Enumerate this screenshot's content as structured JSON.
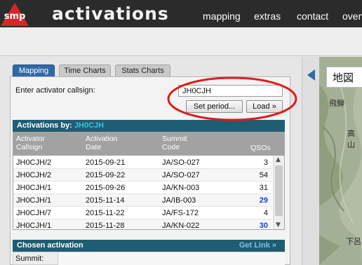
{
  "header": {
    "logo_text": "smp",
    "title": "activations",
    "nav": [
      "mapping",
      "extras",
      "contact",
      "overv"
    ]
  },
  "tabs": {
    "mapping": "Mapping",
    "time_charts": "Time Charts",
    "stats_charts": "Stats Charts"
  },
  "form": {
    "callsign_label": "Enter activator callsign:",
    "callsign_value": "JH0CJH",
    "set_period_button": "Set period...",
    "load_button": "Load »"
  },
  "activations": {
    "header_label": "Activations by:",
    "header_callsign": "JH0CJH",
    "columns": {
      "activator": [
        "Activator",
        "Callsign"
      ],
      "date": [
        "Activation",
        "Date"
      ],
      "summit": [
        "Summit",
        "Code"
      ],
      "qsos": "QSOs"
    },
    "rows": [
      {
        "callsign": "JH0CJH/2",
        "date": "2015-09-21",
        "summit": "JA/SO-027",
        "qsos": "3"
      },
      {
        "callsign": "JH0CJH/2",
        "date": "2015-09-22",
        "summit": "JA/SO-027",
        "qsos": "54"
      },
      {
        "callsign": "JH0CJH/1",
        "date": "2015-09-26",
        "summit": "JA/KN-003",
        "qsos": "31"
      },
      {
        "callsign": "JH0CJH/1",
        "date": "2015-11-14",
        "summit": "JA/IB-003",
        "qsos": "29"
      },
      {
        "callsign": "JH0CJH/7",
        "date": "2015-11-22",
        "summit": "JA/FS-172",
        "qsos": "4"
      },
      {
        "callsign": "JH0CJH/1",
        "date": "2015-11-28",
        "summit": "JA/KN-022",
        "qsos": "30"
      }
    ]
  },
  "chosen": {
    "title": "Chosen activation",
    "get_link": "Get Link »",
    "summit_label": "Summit:"
  },
  "map": {
    "label": "地図",
    "places": [
      "飛騨",
      "高山",
      "下呂"
    ]
  },
  "colors": {
    "topbar": "#2b2b2b",
    "tab_active": "#2f6aa8",
    "section_header": "#1f5d73",
    "callsign_accent": "#37c3e0",
    "qso_highlight": "#1d3fd0",
    "annotation_circle": "#e01b1b",
    "logo_red": "#d6262b"
  }
}
